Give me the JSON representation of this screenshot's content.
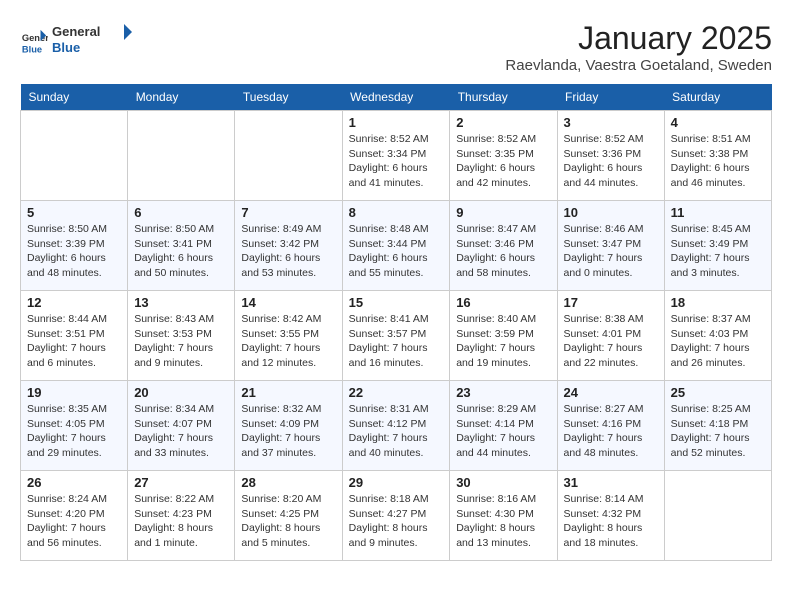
{
  "header": {
    "logo": {
      "general": "General",
      "blue": "Blue"
    },
    "title": "January 2025",
    "location": "Raevlanda, Vaestra Goetaland, Sweden"
  },
  "weekdays": [
    "Sunday",
    "Monday",
    "Tuesday",
    "Wednesday",
    "Thursday",
    "Friday",
    "Saturday"
  ],
  "weeks": [
    [
      {
        "day": "",
        "info": ""
      },
      {
        "day": "",
        "info": ""
      },
      {
        "day": "",
        "info": ""
      },
      {
        "day": "1",
        "info": "Sunrise: 8:52 AM\nSunset: 3:34 PM\nDaylight: 6 hours\nand 41 minutes."
      },
      {
        "day": "2",
        "info": "Sunrise: 8:52 AM\nSunset: 3:35 PM\nDaylight: 6 hours\nand 42 minutes."
      },
      {
        "day": "3",
        "info": "Sunrise: 8:52 AM\nSunset: 3:36 PM\nDaylight: 6 hours\nand 44 minutes."
      },
      {
        "day": "4",
        "info": "Sunrise: 8:51 AM\nSunset: 3:38 PM\nDaylight: 6 hours\nand 46 minutes."
      }
    ],
    [
      {
        "day": "5",
        "info": "Sunrise: 8:50 AM\nSunset: 3:39 PM\nDaylight: 6 hours\nand 48 minutes."
      },
      {
        "day": "6",
        "info": "Sunrise: 8:50 AM\nSunset: 3:41 PM\nDaylight: 6 hours\nand 50 minutes."
      },
      {
        "day": "7",
        "info": "Sunrise: 8:49 AM\nSunset: 3:42 PM\nDaylight: 6 hours\nand 53 minutes."
      },
      {
        "day": "8",
        "info": "Sunrise: 8:48 AM\nSunset: 3:44 PM\nDaylight: 6 hours\nand 55 minutes."
      },
      {
        "day": "9",
        "info": "Sunrise: 8:47 AM\nSunset: 3:46 PM\nDaylight: 6 hours\nand 58 minutes."
      },
      {
        "day": "10",
        "info": "Sunrise: 8:46 AM\nSunset: 3:47 PM\nDaylight: 7 hours\nand 0 minutes."
      },
      {
        "day": "11",
        "info": "Sunrise: 8:45 AM\nSunset: 3:49 PM\nDaylight: 7 hours\nand 3 minutes."
      }
    ],
    [
      {
        "day": "12",
        "info": "Sunrise: 8:44 AM\nSunset: 3:51 PM\nDaylight: 7 hours\nand 6 minutes."
      },
      {
        "day": "13",
        "info": "Sunrise: 8:43 AM\nSunset: 3:53 PM\nDaylight: 7 hours\nand 9 minutes."
      },
      {
        "day": "14",
        "info": "Sunrise: 8:42 AM\nSunset: 3:55 PM\nDaylight: 7 hours\nand 12 minutes."
      },
      {
        "day": "15",
        "info": "Sunrise: 8:41 AM\nSunset: 3:57 PM\nDaylight: 7 hours\nand 16 minutes."
      },
      {
        "day": "16",
        "info": "Sunrise: 8:40 AM\nSunset: 3:59 PM\nDaylight: 7 hours\nand 19 minutes."
      },
      {
        "day": "17",
        "info": "Sunrise: 8:38 AM\nSunset: 4:01 PM\nDaylight: 7 hours\nand 22 minutes."
      },
      {
        "day": "18",
        "info": "Sunrise: 8:37 AM\nSunset: 4:03 PM\nDaylight: 7 hours\nand 26 minutes."
      }
    ],
    [
      {
        "day": "19",
        "info": "Sunrise: 8:35 AM\nSunset: 4:05 PM\nDaylight: 7 hours\nand 29 minutes."
      },
      {
        "day": "20",
        "info": "Sunrise: 8:34 AM\nSunset: 4:07 PM\nDaylight: 7 hours\nand 33 minutes."
      },
      {
        "day": "21",
        "info": "Sunrise: 8:32 AM\nSunset: 4:09 PM\nDaylight: 7 hours\nand 37 minutes."
      },
      {
        "day": "22",
        "info": "Sunrise: 8:31 AM\nSunset: 4:12 PM\nDaylight: 7 hours\nand 40 minutes."
      },
      {
        "day": "23",
        "info": "Sunrise: 8:29 AM\nSunset: 4:14 PM\nDaylight: 7 hours\nand 44 minutes."
      },
      {
        "day": "24",
        "info": "Sunrise: 8:27 AM\nSunset: 4:16 PM\nDaylight: 7 hours\nand 48 minutes."
      },
      {
        "day": "25",
        "info": "Sunrise: 8:25 AM\nSunset: 4:18 PM\nDaylight: 7 hours\nand 52 minutes."
      }
    ],
    [
      {
        "day": "26",
        "info": "Sunrise: 8:24 AM\nSunset: 4:20 PM\nDaylight: 7 hours\nand 56 minutes."
      },
      {
        "day": "27",
        "info": "Sunrise: 8:22 AM\nSunset: 4:23 PM\nDaylight: 8 hours\nand 1 minute."
      },
      {
        "day": "28",
        "info": "Sunrise: 8:20 AM\nSunset: 4:25 PM\nDaylight: 8 hours\nand 5 minutes."
      },
      {
        "day": "29",
        "info": "Sunrise: 8:18 AM\nSunset: 4:27 PM\nDaylight: 8 hours\nand 9 minutes."
      },
      {
        "day": "30",
        "info": "Sunrise: 8:16 AM\nSunset: 4:30 PM\nDaylight: 8 hours\nand 13 minutes."
      },
      {
        "day": "31",
        "info": "Sunrise: 8:14 AM\nSunset: 4:32 PM\nDaylight: 8 hours\nand 18 minutes."
      },
      {
        "day": "",
        "info": ""
      }
    ]
  ]
}
